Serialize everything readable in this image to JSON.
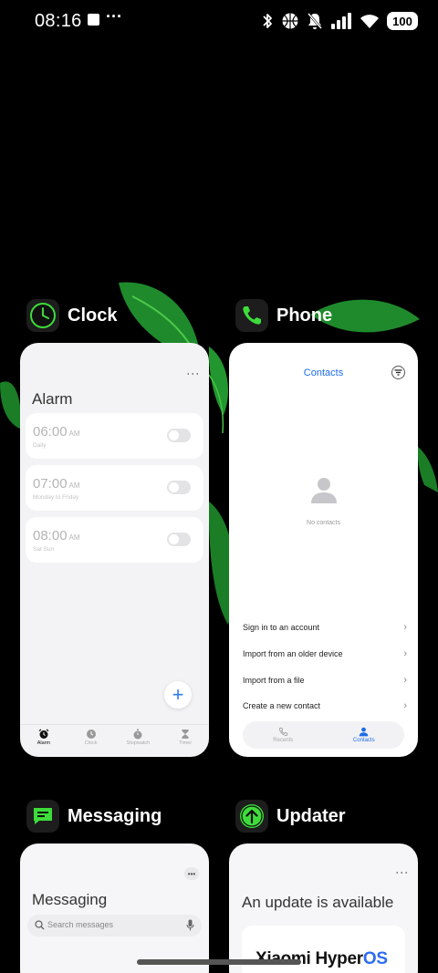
{
  "status_bar": {
    "time": "08:16",
    "overflow": "···",
    "battery": "100"
  },
  "apps": {
    "clock": {
      "name": "Clock",
      "title": "Alarm",
      "alarms": [
        {
          "time": "06:00",
          "ampm": "AM",
          "repeat": "Daily",
          "enabled": false
        },
        {
          "time": "07:00",
          "ampm": "AM",
          "repeat": "Monday to Friday",
          "enabled": false
        },
        {
          "time": "08:00",
          "ampm": "AM",
          "repeat": "Sat Sun",
          "enabled": false
        }
      ],
      "add_label": "+",
      "tabs": [
        "Alarm",
        "Clock",
        "Stopwatch",
        "Timer"
      ],
      "active_tab": "Alarm"
    },
    "phone": {
      "name": "Phone",
      "title": "Contacts",
      "empty_text": "No contacts",
      "actions": [
        "Sign in to an account",
        "Import from an older device",
        "Import from a file",
        "Create a new contact"
      ],
      "tabs": [
        "Recents",
        "Contacts"
      ],
      "active_tab": "Contacts"
    },
    "messaging": {
      "name": "Messaging",
      "title": "Messaging",
      "search_placeholder": "Search messages"
    },
    "updater": {
      "name": "Updater",
      "title": "An update is available",
      "brand_main": "Xiaomi Hyper",
      "brand_suffix": "OS"
    }
  },
  "colors": {
    "accent_blue": "#1e6ce8",
    "brand_green": "#3ddc3a",
    "background": "#000000"
  },
  "icons": {
    "clock_app": "clock-icon",
    "phone_app": "phone-icon",
    "messaging_app": "message-icon",
    "updater_app": "upload-arrow-icon"
  }
}
